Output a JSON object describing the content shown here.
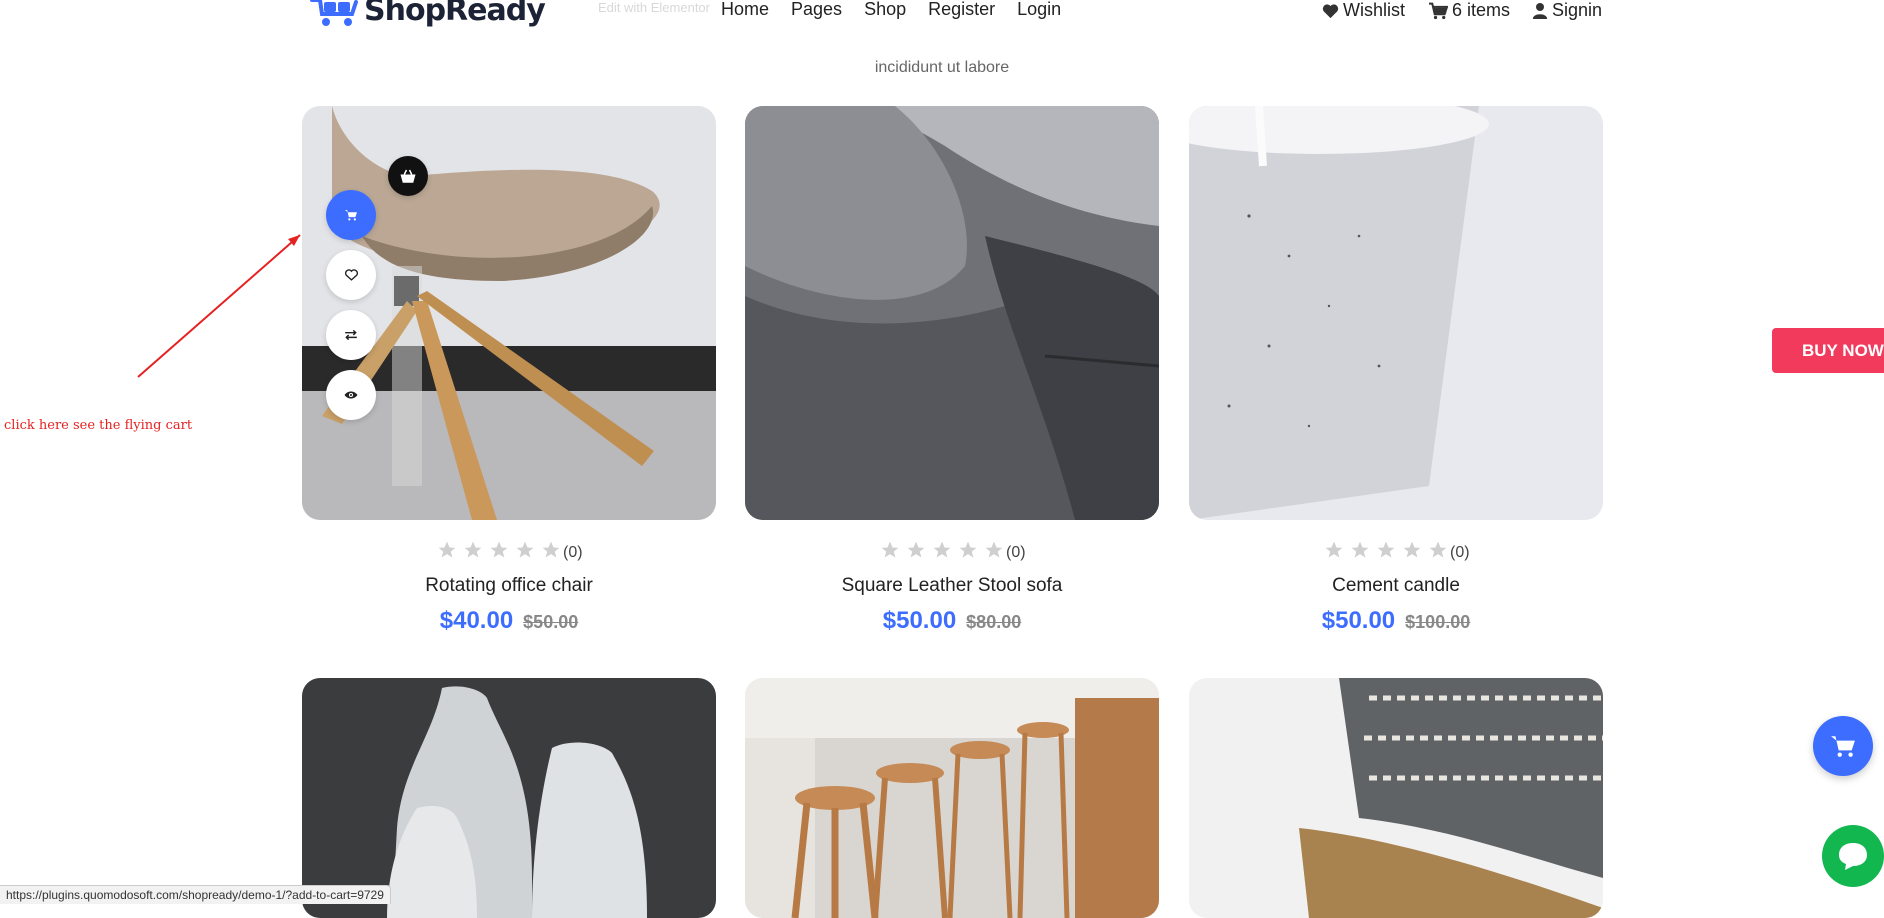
{
  "header": {
    "brand": "ShopReady",
    "edit_link": "Edit with Elementor",
    "nav": [
      {
        "label": "Home"
      },
      {
        "label": "Pages"
      },
      {
        "label": "Shop"
      },
      {
        "label": "Register"
      },
      {
        "label": "Login"
      }
    ],
    "wishlist_label": "Wishlist",
    "cart_label": "6 items",
    "signin_label": "Signin"
  },
  "intro_text": "incididunt ut labore",
  "products": [
    {
      "name": "Rotating office chair",
      "price": "$40.00",
      "old_price": "$50.00",
      "reviews": "(0)",
      "rating": 0
    },
    {
      "name": "Square Leather Stool sofa",
      "price": "$50.00",
      "old_price": "$80.00",
      "reviews": "(0)",
      "rating": 0
    },
    {
      "name": "Cement candle",
      "price": "$50.00",
      "old_price": "$100.00",
      "reviews": "(0)",
      "rating": 0
    }
  ],
  "card_actions": [
    "cart-icon",
    "heart-icon",
    "compare-icon",
    "eye-icon",
    "basket-icon"
  ],
  "annotation_text": "click here see the flying cart",
  "buy_now_label": "BUY NOW",
  "status_url": "https://plugins.quomodosoft.com/shopready/demo-1/?add-to-cart=9729",
  "colors": {
    "accent": "#3d6dff",
    "buy_now": "#f13a5c",
    "chat": "#12b84f",
    "annotation": "#e52222"
  }
}
